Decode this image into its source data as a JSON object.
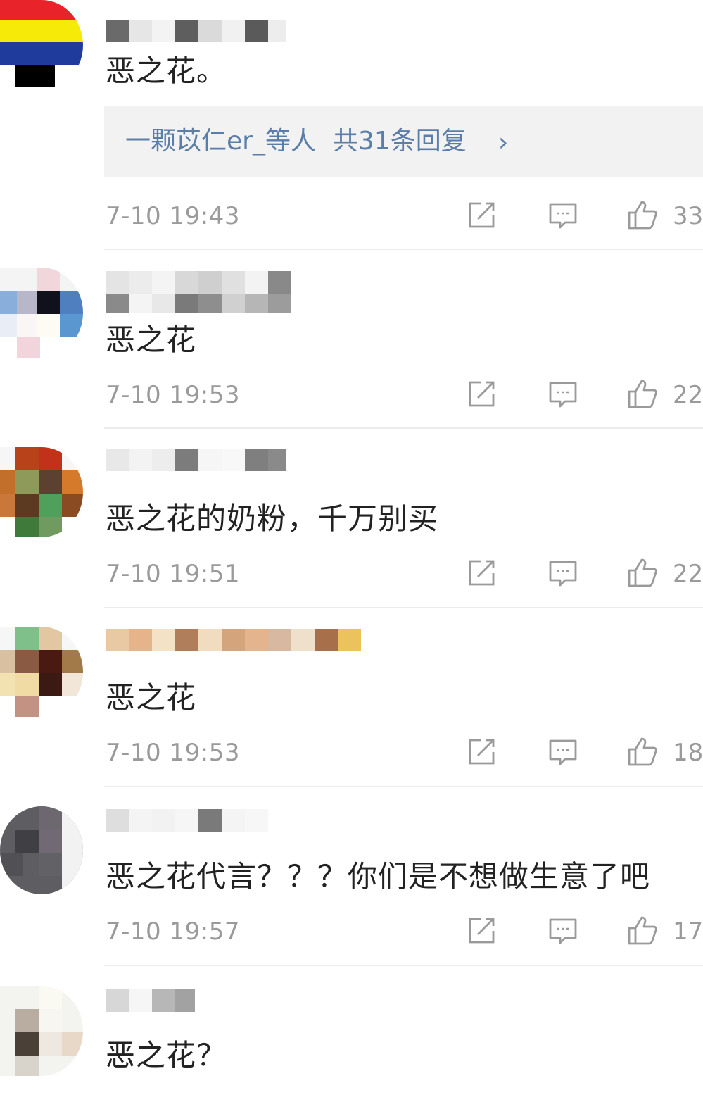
{
  "comments": [
    {
      "text": "恶之花。",
      "time": "7-10 19:43",
      "likes": "33",
      "replies": {
        "names": "一颗苡仁er_等人",
        "count": "共31条回复",
        "chevron": "›"
      }
    },
    {
      "text": "恶之花",
      "time": "7-10 19:53",
      "likes": "22"
    },
    {
      "text": "恶之花的奶粉，千万别买",
      "time": "7-10 19:51",
      "likes": "22"
    },
    {
      "text": "恶之花",
      "time": "7-10 19:53",
      "likes": "18"
    },
    {
      "text": "恶之花代言？？？你们是不想做生意了吧",
      "time": "7-10 19:57",
      "likes": "17"
    },
    {
      "text": "恶之花？"
    }
  ],
  "icons": {
    "share": "share-edit-icon",
    "comment": "comment-bubble-icon",
    "like": "thumbs-up-icon"
  },
  "colors": {
    "reply_link": "#5b7ea8",
    "meta_text": "#9a9a9a",
    "reply_bg": "#f2f2f2"
  }
}
